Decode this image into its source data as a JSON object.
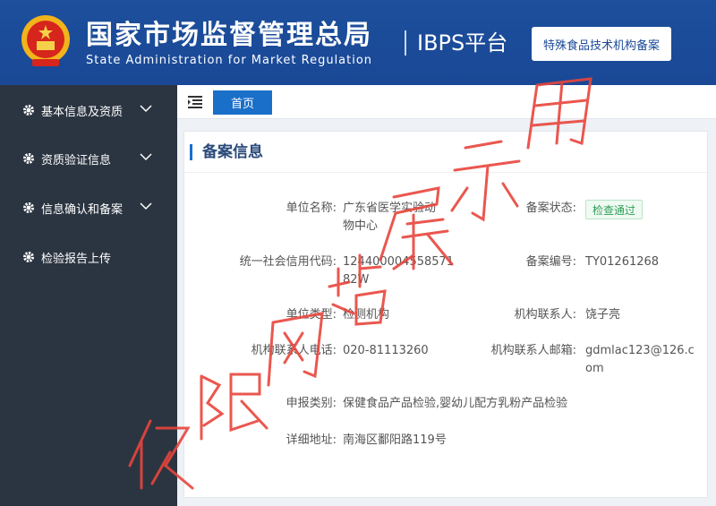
{
  "header": {
    "title_cn": "国家市场监督管理总局",
    "title_en": "State Administration for Market Regulation",
    "platform": "IBPS平台",
    "filing_button": "特殊食品技术机构备案",
    "brand_color": "#1a4896"
  },
  "sidebar": {
    "items": [
      {
        "label": "基本信息及资质",
        "icon": "gear-icon",
        "expandable": true
      },
      {
        "label": "资质验证信息",
        "icon": "gear-icon",
        "expandable": true
      },
      {
        "label": "信息确认和备案",
        "icon": "gear-icon",
        "expandable": true
      },
      {
        "label": "检验报告上传",
        "icon": "gear-icon",
        "expandable": false
      }
    ]
  },
  "tabs": {
    "home": "首页"
  },
  "panel": {
    "title": "备案信息",
    "fields": {
      "unit_name": {
        "label": "单位名称:",
        "value": [
          "广东省医学实验动",
          "物中心"
        ]
      },
      "filing_status": {
        "label": "备案状态:",
        "value": "检查通过"
      },
      "credit_code": {
        "label": "统一社会信用代码:",
        "value": [
          "124400004558571",
          "82W"
        ]
      },
      "filing_number": {
        "label": "备案编号:",
        "value": "TY01261268"
      },
      "unit_type": {
        "label": "单位类型:",
        "value": "检测机构"
      },
      "contact_person": {
        "label": "机构联系人:",
        "value": "饶子亮"
      },
      "contact_phone": {
        "label": "机构联系人电话:",
        "value": "020-81113260"
      },
      "contact_email": {
        "label": "机构联系人邮箱:",
        "value": [
          "gdmlac123@126.c",
          "om"
        ]
      },
      "report_category": {
        "label": "申报类别:",
        "value": "保健食品产品检验,婴幼儿配方乳粉产品检验"
      },
      "address": {
        "label": "详细地址:",
        "value": "南海区鄱阳路119号"
      }
    }
  },
  "watermark": {
    "text": "仅限网站展示用",
    "color": "#e8453c"
  }
}
